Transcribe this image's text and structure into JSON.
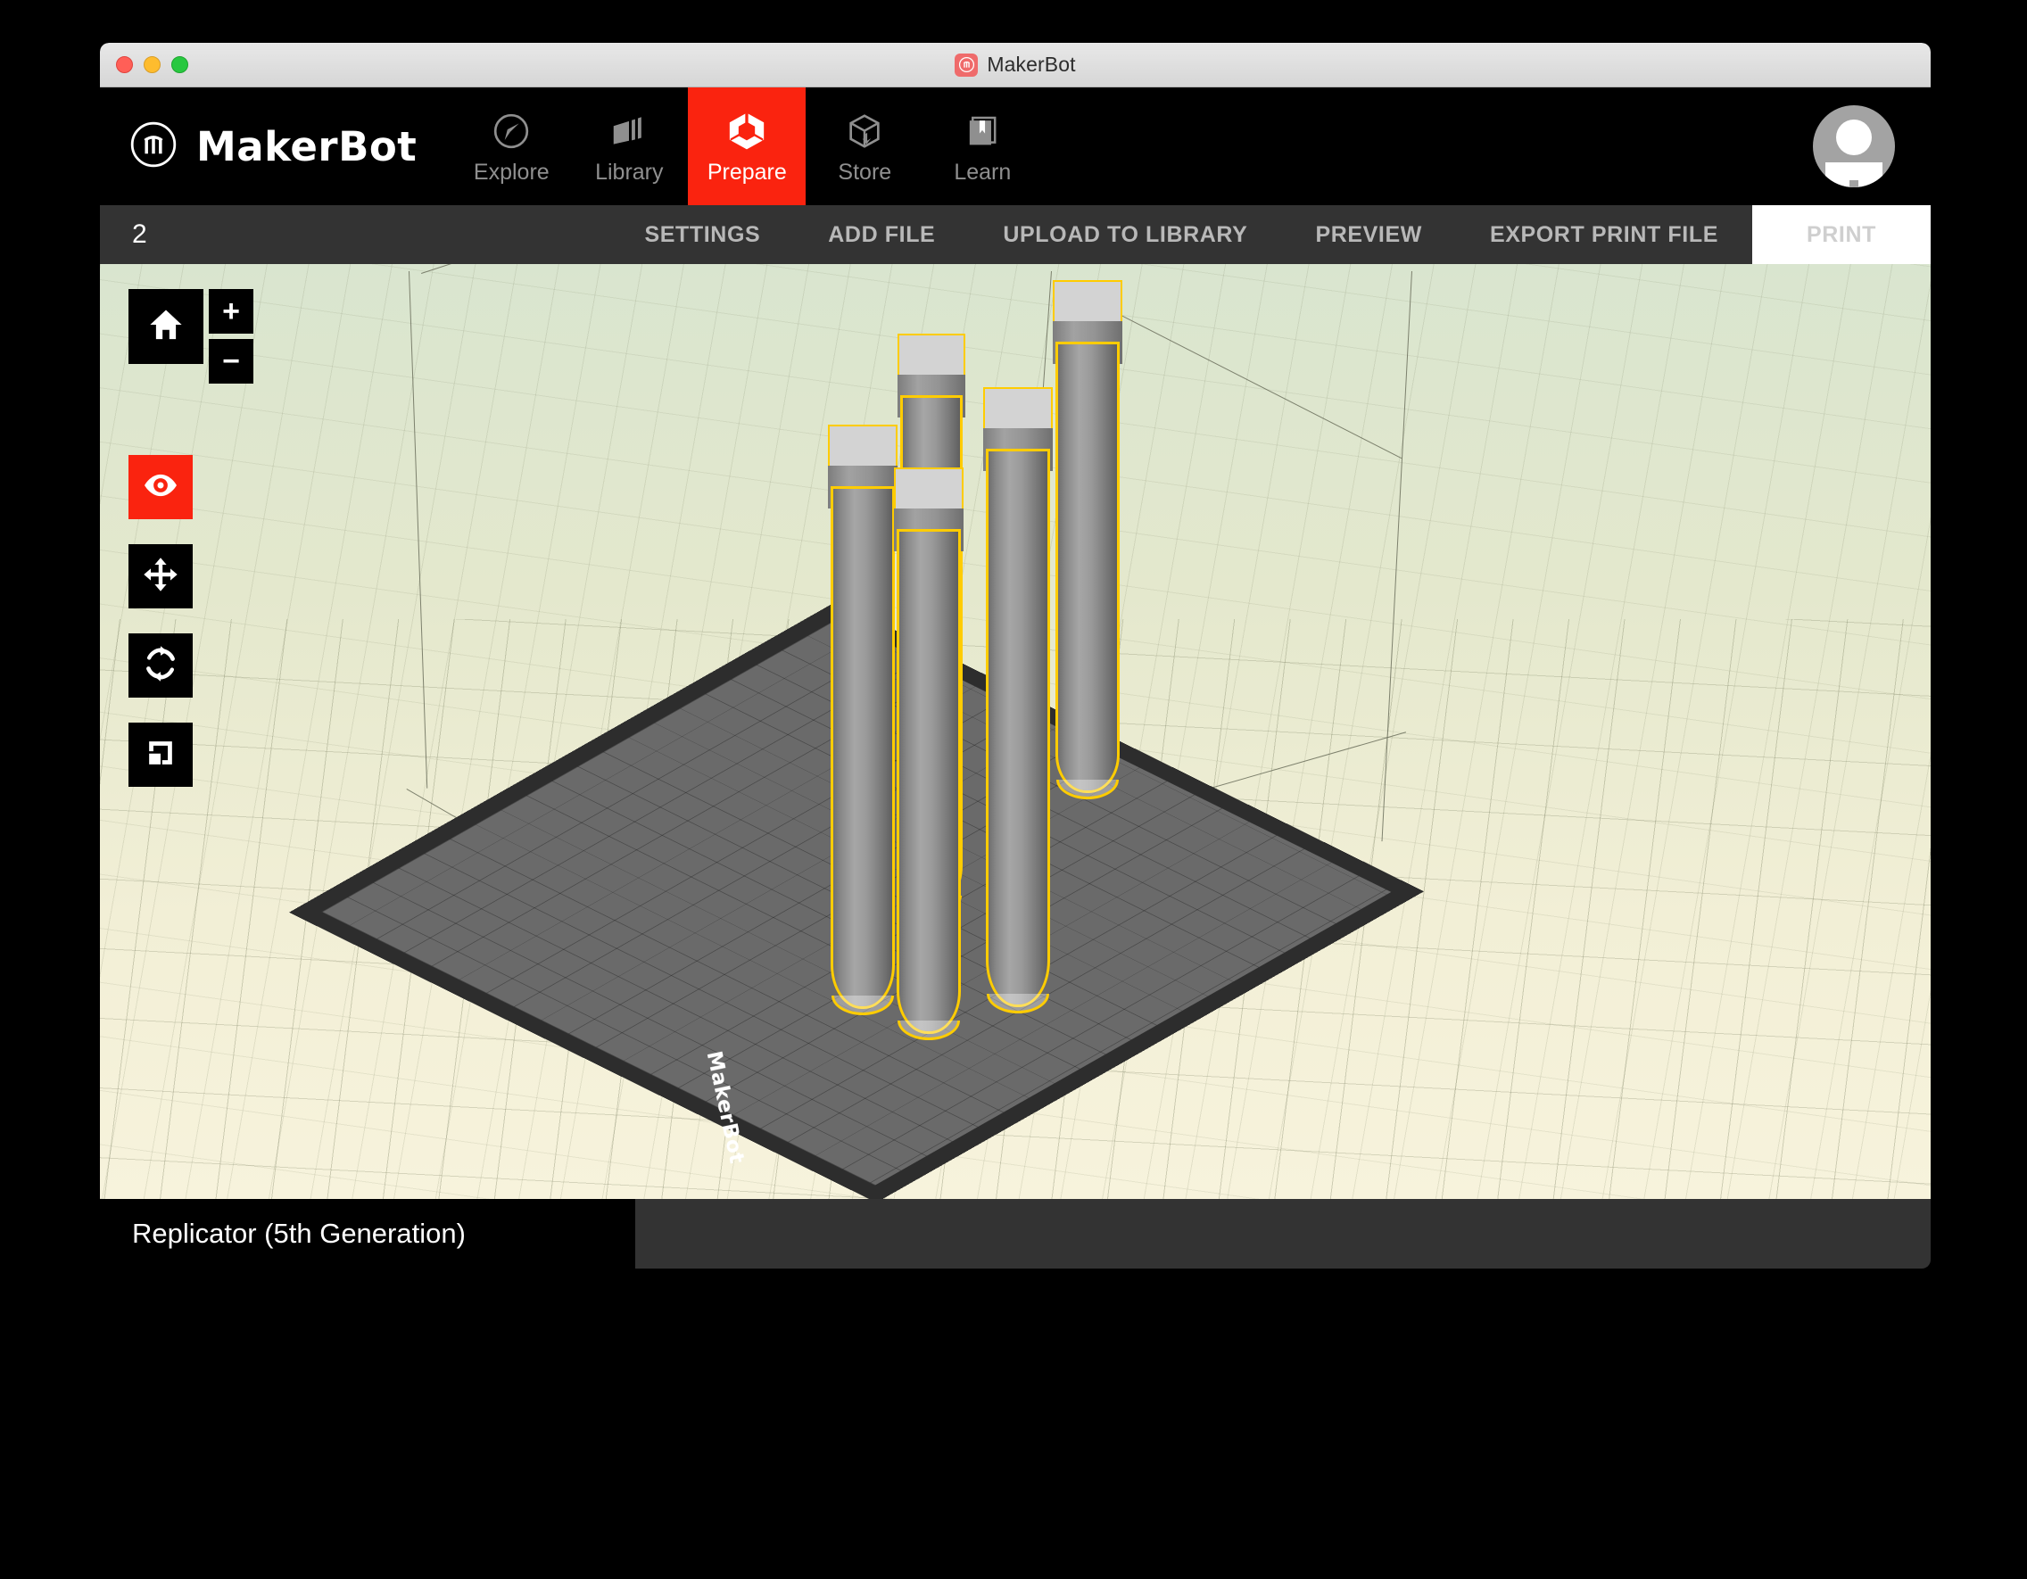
{
  "window": {
    "title": "MakerBot",
    "app_icon": "makerbot-logo-icon",
    "traffic_lights": [
      "close",
      "minimize",
      "zoom"
    ]
  },
  "brand": {
    "wordmark": "MakerBot",
    "logo_icon": "makerbot-circle-m-icon"
  },
  "nav": {
    "items": [
      {
        "label": "Explore",
        "icon": "compass-icon",
        "active": false
      },
      {
        "label": "Library",
        "icon": "layers-icon",
        "active": false
      },
      {
        "label": "Prepare",
        "icon": "prepare-cube-icon",
        "active": true
      },
      {
        "label": "Store",
        "icon": "box-download-icon",
        "active": false
      },
      {
        "label": "Learn",
        "icon": "book-bookmark-icon",
        "active": false
      }
    ],
    "avatar": "user-avatar-icon"
  },
  "toolbar": {
    "object_count": "2",
    "actions": [
      {
        "label": "SETTINGS",
        "primary": false
      },
      {
        "label": "ADD FILE",
        "primary": false
      },
      {
        "label": "UPLOAD TO LIBRARY",
        "primary": false
      },
      {
        "label": "PREVIEW",
        "primary": false
      },
      {
        "label": "EXPORT PRINT FILE",
        "primary": false
      },
      {
        "label": "PRINT",
        "primary": true
      }
    ]
  },
  "tools": {
    "home": {
      "icon": "home-icon",
      "active": false
    },
    "zoom_in": {
      "label": "+",
      "icon": "plus-icon"
    },
    "zoom_out": {
      "label": "−",
      "icon": "minus-icon"
    },
    "items": [
      {
        "icon": "eye-view-icon",
        "active": true
      },
      {
        "icon": "move-arrows-icon",
        "active": false
      },
      {
        "icon": "rotate-icon",
        "active": false
      },
      {
        "icon": "scale-icon",
        "active": false
      }
    ]
  },
  "viewport": {
    "plate_brand": "MakerBot",
    "selection_color": "#ffcc00",
    "background_top": "#d9e5cf",
    "background_bottom": "#f7f3dc",
    "model_count": 5
  },
  "status": {
    "printer_name": "Replicator (5th Generation)"
  },
  "colors": {
    "accent_red": "#fa230f",
    "toolbar_bg": "#333333",
    "nav_bg": "#000000",
    "selection_yellow": "#ffcc00"
  }
}
